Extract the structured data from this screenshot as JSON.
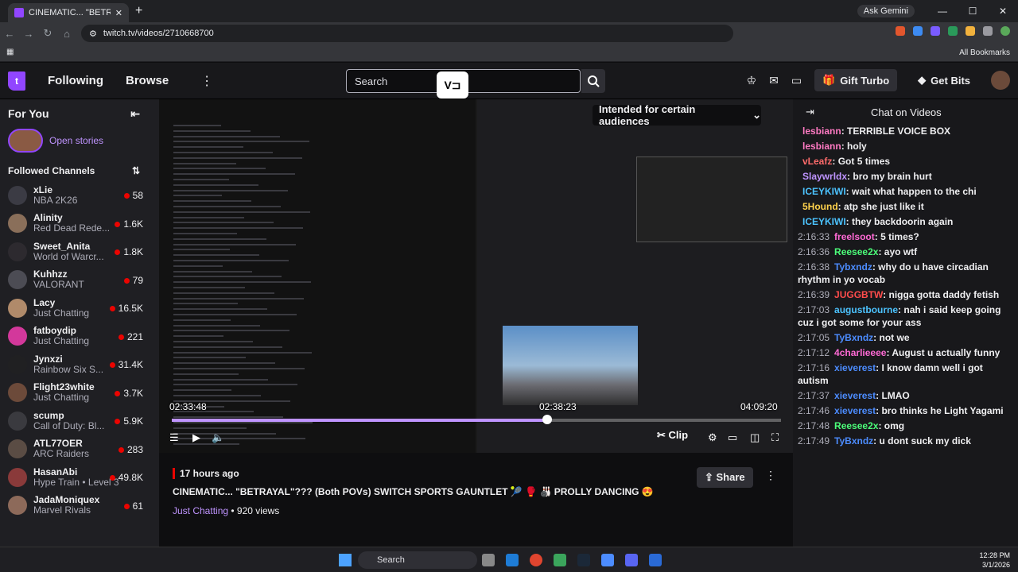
{
  "browser": {
    "tab_title": "CINEMATIC... \"BETRAYAL\"??? (B",
    "new_tab": "+",
    "gemini": "Ask Gemini",
    "url": "twitch.tv/videos/2710668700",
    "all_bookmarks": "All Bookmarks",
    "min": "—",
    "max": "☐",
    "close": "✕"
  },
  "topnav": {
    "following": "Following",
    "browse": "Browse",
    "more": "⋮",
    "search_placeholder": "Search",
    "vd_badge": "V⊐",
    "gift_turbo": "Gift Turbo",
    "get_bits": "Get Bits"
  },
  "sidebar": {
    "for_you": "For You",
    "open_stories": "Open stories",
    "followed_channels": "Followed Channels",
    "channels": [
      {
        "name": "xLie",
        "game": "NBA 2K26",
        "viewers": "58",
        "color": "#3b3b44"
      },
      {
        "name": "Alinity",
        "game": "Red Dead Rede...",
        "viewers": "1.6K",
        "color": "#8a6f5a"
      },
      {
        "name": "Sweet_Anita",
        "game": "World of Warcr...",
        "viewers": "1.8K",
        "color": "#2d2a2f"
      },
      {
        "name": "Kuhhzz",
        "game": "VALORANT",
        "viewers": "79",
        "color": "#4c4c54"
      },
      {
        "name": "Lacy",
        "game": "Just Chatting",
        "viewers": "16.5K",
        "color": "#b08a6a"
      },
      {
        "name": "fatboydip",
        "game": "Just Chatting",
        "viewers": "221",
        "color": "#d3389b"
      },
      {
        "name": "Jynxzi",
        "game": "Rainbow Six S...",
        "viewers": "31.4K",
        "color": "#202022"
      },
      {
        "name": "Flight23white",
        "game": "Just Chatting",
        "viewers": "3.7K",
        "color": "#6c4a3a"
      },
      {
        "name": "scump",
        "game": "Call of Duty: Bl...",
        "viewers": "5.9K",
        "color": "#3a3a3f"
      },
      {
        "name": "ATL77OER",
        "game": "ARC Raiders",
        "viewers": "283",
        "color": "#5a4c44"
      },
      {
        "name": "HasanAbi",
        "game": "Hype Train • Level 3",
        "viewers": "49.8K",
        "color": "#8a3a3a"
      },
      {
        "name": "JadaMoniquex",
        "game": "Marvel Rivals",
        "viewers": "61",
        "color": "#8d6a5a"
      }
    ]
  },
  "video": {
    "audience_notice": "Intended for certain audiences",
    "time_left": "02:33:48",
    "time_hover": "02:38:23",
    "time_total": "04:09:20",
    "progress": 0.616,
    "clip": "Clip"
  },
  "info": {
    "ago": "17 hours ago",
    "title": "CINEMATIC... \"BETRAYAL\"??? (Both POVs) SWITCH SPORTS GAUNTLET 🎾 🥊 🎳 PROLLY DANCING 😍",
    "category": "Just Chatting",
    "views": "• 920 views",
    "share": "Share"
  },
  "chat": {
    "header": "Chat on Videos",
    "messages": [
      {
        "ts": "",
        "user": "lesbiann",
        "color": "#ff7ac3",
        "text": "TERRIBLE VOICE BOX"
      },
      {
        "ts": "",
        "user": "lesbiann",
        "color": "#ff7ac3",
        "text": "holy"
      },
      {
        "ts": "",
        "user": "vLeafz",
        "color": "#ff6b6b",
        "text": "Got 5 times"
      },
      {
        "ts": "",
        "user": "Slaywrldx",
        "color": "#bf94ff",
        "text": "bro my brain hurt"
      },
      {
        "ts": "",
        "user": "ICEYKIWI",
        "color": "#4cc3ff",
        "text": "wait what happen to the chi"
      },
      {
        "ts": "",
        "user": "5Hound",
        "color": "#ffd24c",
        "text": "atp she just like it"
      },
      {
        "ts": "",
        "user": "ICEYKIWI",
        "color": "#4cc3ff",
        "text": "they backdoorin again"
      },
      {
        "ts": "2:16:33",
        "user": "freelsoot",
        "color": "#ff6ad5",
        "text": "5 times?"
      },
      {
        "ts": "2:16:36",
        "user": "Reesee2x",
        "color": "#4cff7a",
        "text": "ayo wtf"
      },
      {
        "ts": "2:16:38",
        "user": "Tybxndz",
        "color": "#4c8cff",
        "text": "why do u have circadian rhythm in yo vocab"
      },
      {
        "ts": "2:16:39",
        "user": "JUGGBTW",
        "color": "#ff4c4c",
        "text": "nigga gotta daddy fetish"
      },
      {
        "ts": "2:17:03",
        "user": "augustbourne",
        "color": "#4cc3ff",
        "text": "nah i said keep going cuz i got some for your ass"
      },
      {
        "ts": "2:17:05",
        "user": "TyBxndz",
        "color": "#4c8cff",
        "text": "not we"
      },
      {
        "ts": "2:17:12",
        "user": "4charlieeee",
        "color": "#ff6ad5",
        "text": "August u actually funny"
      },
      {
        "ts": "2:17:16",
        "user": "xieverest",
        "color": "#4c8cff",
        "text": "I know damn well i got autism"
      },
      {
        "ts": "2:17:37",
        "user": "xieverest",
        "color": "#4c8cff",
        "text": "LMAO"
      },
      {
        "ts": "2:17:46",
        "user": "xieverest",
        "color": "#4c8cff",
        "text": "bro thinks he Light Yagami"
      },
      {
        "ts": "2:17:48",
        "user": "Reesee2x",
        "color": "#4cff7a",
        "text": "omg"
      },
      {
        "ts": "2:17:49",
        "user": "TyBxndz",
        "color": "#4c8cff",
        "text": "u dont suck my dick"
      }
    ]
  },
  "taskbar": {
    "search": "Search",
    "time": "12:28 PM",
    "date": "3/1/2026"
  }
}
